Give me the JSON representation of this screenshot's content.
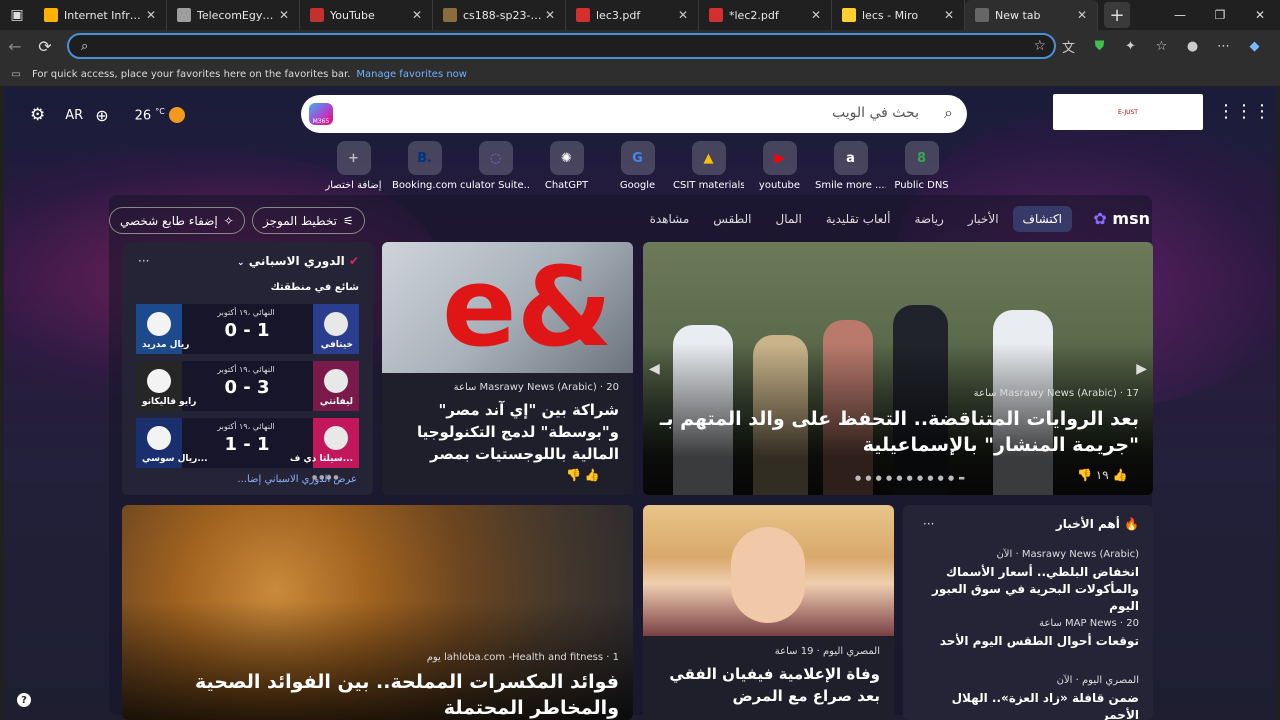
{
  "tabs": [
    {
      "label": "Internet Infrastruct",
      "icon": "network-icon"
    },
    {
      "label": "TelecomEgyptInfra",
      "icon": "globe-icon"
    },
    {
      "label": "YouTube",
      "icon": "youtube-icon"
    },
    {
      "label": "cs188-sp23-lec07",
      "icon": "doc-icon"
    },
    {
      "label": "lec3.pdf",
      "icon": "pdf-icon"
    },
    {
      "label": "*lec2.pdf",
      "icon": "pdf-icon"
    },
    {
      "label": "lecs - Miro",
      "icon": "miro-icon"
    },
    {
      "label": "New tab",
      "icon": "newtab-icon"
    }
  ],
  "favbar": {
    "text": "For quick access, place your favorites here on the favorites bar.",
    "link": "Manage favorites now"
  },
  "top": {
    "lang": "AR",
    "temp": "26",
    "unit": "°C",
    "search_placeholder": "بحث في الويب",
    "m365": "M365"
  },
  "quick_links": [
    {
      "label": "Public DNS",
      "icon": "dns-icon",
      "glyph": "8",
      "color": "#34a853"
    },
    {
      "label": "Smile more ....",
      "icon": "amazon-icon",
      "glyph": "a",
      "color": "#ffffff"
    },
    {
      "label": "youtube",
      "icon": "youtube-icon",
      "glyph": "▶",
      "color": "#ff0000"
    },
    {
      "label": "CSIT materials",
      "icon": "drive-icon",
      "glyph": "▲",
      "color": "#fbbc04"
    },
    {
      "label": "Google",
      "icon": "google-icon",
      "glyph": "G",
      "color": "#4285f4"
    },
    {
      "label": "ChatGPT",
      "icon": "chatgpt-icon",
      "glyph": "✺",
      "color": "#ffffff"
    },
    {
      "label": "culator Suite...",
      "icon": "calculator-icon",
      "glyph": "◌",
      "color": "#7b6cff"
    },
    {
      "label": "Booking.com",
      "icon": "booking-icon",
      "glyph": "B.",
      "color": "#003580"
    },
    {
      "label": "إضافة اختصار",
      "icon": "plus-icon",
      "glyph": "+",
      "color": "#bbbbbb"
    }
  ],
  "feed": {
    "logo": "msn",
    "tabs": [
      "اكتشاف",
      "الأخبار",
      "رياضة",
      "ألعاب تقليدية",
      "المال",
      "الطقس",
      "مشاهدة"
    ],
    "layout_btn": "تخطيط الموجز",
    "personalize_btn": "إضفاء طابع شخصي"
  },
  "hero": {
    "source": "Masrawy News (Arabic) · 17 ساعة",
    "title": "بعد الروايات المتناقضة.. التحفظ على والد المتهم بـ \"جريمة المنشار\" بالإسماعيلية",
    "likes": "١٩"
  },
  "card2": {
    "source": "Masrawy News (Arabic) · 20 ساعة",
    "title": "شراكة بين \"إي آند مصر\" و\"بوسطة\" لدمج التكنولوجيا المالية باللوجستيات بمصر"
  },
  "sports": {
    "league": "الدوري الاسباني",
    "trending": "شائع في منطقتك",
    "footer": "عرض الدوري الاسباني إضا...",
    "matches": [
      {
        "home": "خيتافي",
        "away": "ريال مدريد",
        "score": "0 - 1",
        "status": "النهائي ،١٩ أكتوبر",
        "hcolor": "#2a3d8f",
        "acolor": "#1c4a8c"
      },
      {
        "home": "ليفانتي",
        "away": "رايو فاليكانو",
        "score": "0 - 3",
        "status": "النهائي ،١٩ أكتوبر",
        "hcolor": "#7a1a4a",
        "acolor": "#262626"
      },
      {
        "home": "سيلتا دي ف...",
        "away": "ريال سوسي...",
        "score": "1 - 1",
        "status": "النهائي ،١٩ أكتوبر",
        "hcolor": "#c2185b",
        "acolor": "#1a2f6e"
      }
    ]
  },
  "nuts": {
    "source": "lahloba.com -Health and fitness · 1 يوم",
    "title": "فوائد المكسرات المملحة.. بين الفوائد الصحية والمخاطر المحتملة"
  },
  "vivian": {
    "source": "المصري اليوم · 19 ساعة",
    "title": "وفاة الإعلامية فيفيان الفقي بعد صراع مع المرض"
  },
  "top_news": {
    "header": "أهم الأخبار",
    "items": [
      {
        "source": "Masrawy News (Arabic) · الآن",
        "title": "انخفاض البلطي.. أسعار الأسماك والمأكولات البحرية في سوق العبور اليوم"
      },
      {
        "source": "MAP News · 20 ساعة",
        "title": "توقعات أحوال الطقس اليوم الأحد"
      },
      {
        "source": "المصري اليوم · الآن",
        "title": "ضمن قافلة «زاد العزة».. الهلال الأحمر"
      }
    ]
  }
}
